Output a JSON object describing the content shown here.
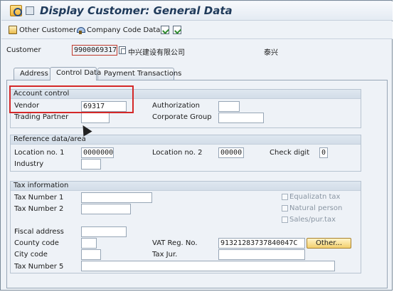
{
  "window": {
    "title": "Display Customer: General Data"
  },
  "toolbar": {
    "other_customer": "Other Customer",
    "company_code_data": "Company Code Data"
  },
  "header": {
    "customer_label": "Customer",
    "customer_value": "9900069317",
    "customer_name": "中兴建设有限公司",
    "city": "泰兴"
  },
  "tabs": [
    {
      "label": "Address"
    },
    {
      "label": "Control Data"
    },
    {
      "label": "Payment Transactions"
    }
  ],
  "active_tab": "Control Data",
  "account_control": {
    "title": "Account control",
    "vendor_label": "Vendor",
    "vendor_value": "69317",
    "authorization_label": "Authorization",
    "authorization_value": "",
    "trading_partner_label": "Trading Partner",
    "trading_partner_value": "",
    "corporate_group_label": "Corporate Group",
    "corporate_group_value": ""
  },
  "reference_data": {
    "title": "Reference data/area",
    "location1_label": "Location no. 1",
    "location1_value": "0000000",
    "location2_label": "Location no. 2",
    "location2_value": "00000",
    "check_digit_label": "Check digit",
    "check_digit_value": "0",
    "industry_label": "Industry",
    "industry_value": ""
  },
  "tax_information": {
    "title": "Tax information",
    "tax1_label": "Tax Number 1",
    "tax2_label": "Tax Number 2",
    "equalization_label": "Equalizatn tax",
    "natural_person_label": "Natural person",
    "sales_tax_label": "Sales/pur.tax",
    "fiscal_address_label": "Fiscal address",
    "county_code_label": "County code",
    "vat_label": "VAT Reg. No.",
    "vat_value": "91321283737840047C",
    "other_button": "Other...",
    "city_code_label": "City code",
    "tax_jur_label": "Tax Jur.",
    "tax5_label": "Tax Number 5"
  },
  "colors": {
    "highlight": "#d42828",
    "title_text": "#1f3a5a",
    "panel_bg": "#eef2f7"
  }
}
